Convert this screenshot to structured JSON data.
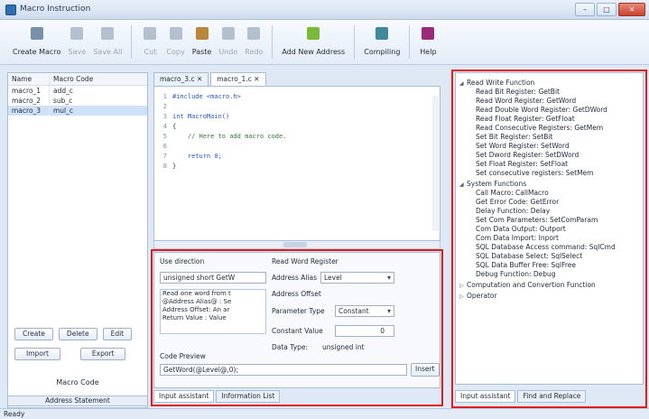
{
  "window": {
    "title": "Macro Instruction"
  },
  "toolbar": [
    {
      "label": "Create Macro",
      "icon": "create-macro-icon",
      "enabled": true,
      "color": "#7a8fa8"
    },
    {
      "label": "Save",
      "icon": "save-icon",
      "enabled": false,
      "color": "#6b7f99"
    },
    {
      "label": "Save All",
      "icon": "save-all-icon",
      "enabled": false,
      "color": "#6b7f99"
    },
    {
      "label": "Cut",
      "icon": "cut-icon",
      "enabled": false,
      "color": "#6b7f99"
    },
    {
      "label": "Copy",
      "icon": "copy-icon",
      "enabled": false,
      "color": "#6b7f99"
    },
    {
      "label": "Paste",
      "icon": "paste-icon",
      "enabled": true,
      "color": "#b9873a"
    },
    {
      "label": "Undo",
      "icon": "undo-icon",
      "enabled": false,
      "color": "#6b7f99"
    },
    {
      "label": "Redo",
      "icon": "redo-icon",
      "enabled": false,
      "color": "#6b7f99"
    },
    {
      "label": "Add New Address",
      "icon": "add-address-icon",
      "enabled": true,
      "color": "#7ab83a"
    },
    {
      "label": "Compiling",
      "icon": "compiling-icon",
      "enabled": true,
      "color": "#3e8a9a"
    },
    {
      "label": "Help",
      "icon": "help-icon",
      "enabled": true,
      "color": "#9b2a7a"
    }
  ],
  "macros": {
    "headers": [
      "Name",
      "Macro Code"
    ],
    "rows": [
      [
        "macro_1",
        "add_c"
      ],
      [
        "macro_2",
        "sub_c"
      ],
      [
        "macro_3",
        "mul_c"
      ]
    ]
  },
  "left_panel": {
    "buttons_row1": [
      "Create",
      "Delete",
      "Edit"
    ],
    "buttons_row2": [
      "Import",
      "Export"
    ],
    "section_label": "Macro Code",
    "tab": "Address Statement"
  },
  "editor": {
    "tabs": [
      "macro_3.c",
      "macro_1.c"
    ],
    "lines": [
      {
        "n": "1",
        "text": "#include <macro.h>"
      },
      {
        "n": "2",
        "text": ""
      },
      {
        "n": "3",
        "text": "int MacroMain()"
      },
      {
        "n": "4",
        "text": "{"
      },
      {
        "n": "5",
        "text": "    // Here to add macro code."
      },
      {
        "n": "6",
        "text": ""
      },
      {
        "n": "7",
        "text": "    return 0;"
      },
      {
        "n": "8",
        "text": "}"
      }
    ]
  },
  "assistant": {
    "use_direction_label": "Use direction",
    "signature": "unsigned short GetW",
    "description": [
      "Read one word from t",
      "@Address Alias@ : Se",
      "Address Offset: An ar",
      "Return Value : Value"
    ],
    "function_title": "Read Word Register",
    "address_alias_label": "Address Alias",
    "address_alias_value": "Level",
    "address_offset_label": "Address Offset",
    "parameter_type_label": "Parameter Type",
    "parameter_type_value": "Constant",
    "constant_value_label": "Constant Value",
    "constant_value": "0",
    "data_type_label": "Data Type:",
    "data_type_value": "unsigned int",
    "code_preview_label": "Code Preview",
    "code_preview": "GetWord(@Level@,0);",
    "insert_label": "Insert"
  },
  "bottom_tabs": [
    "Input assistant",
    "Information List"
  ],
  "tree": {
    "groups": [
      {
        "label": "Read Write Function",
        "expanded": true,
        "items": [
          "Read Bit Register: GetBit",
          "Read Word Register: GetWord",
          "Read Double Word Register: GetDWord",
          "Read Float Register: GetFloat",
          "Read Consecutive Registers: GetMem",
          "Set Bit Register: SetBit",
          "Set Word Register: SetWord",
          "Set Dword Register: SetDWord",
          "Set Float Register: SetFloat",
          "Set consecutive registers: SetMem"
        ]
      },
      {
        "label": "System Functions",
        "expanded": true,
        "items": [
          "Call Macro: CallMacro",
          "Get Error Code: GetError",
          "Delay Function: Delay",
          "Set Com Parameters: SetComParam",
          "Com Data Output: Outport",
          "Com Data Import: Inport",
          "SQL Database Access command: SqlCmd",
          "SQL Database Select: SqlSelect",
          "SQL Data Buffer Free: SqlFree",
          "Debug Function: Debug"
        ]
      },
      {
        "label": "Computation and Convertion Function",
        "expanded": false,
        "items": []
      },
      {
        "label": "Operator",
        "expanded": false,
        "items": []
      }
    ]
  },
  "right_tabs": [
    "Input assistant",
    "Find and Replace"
  ],
  "status": "Ready",
  "highlight_color": "#e31b1b"
}
